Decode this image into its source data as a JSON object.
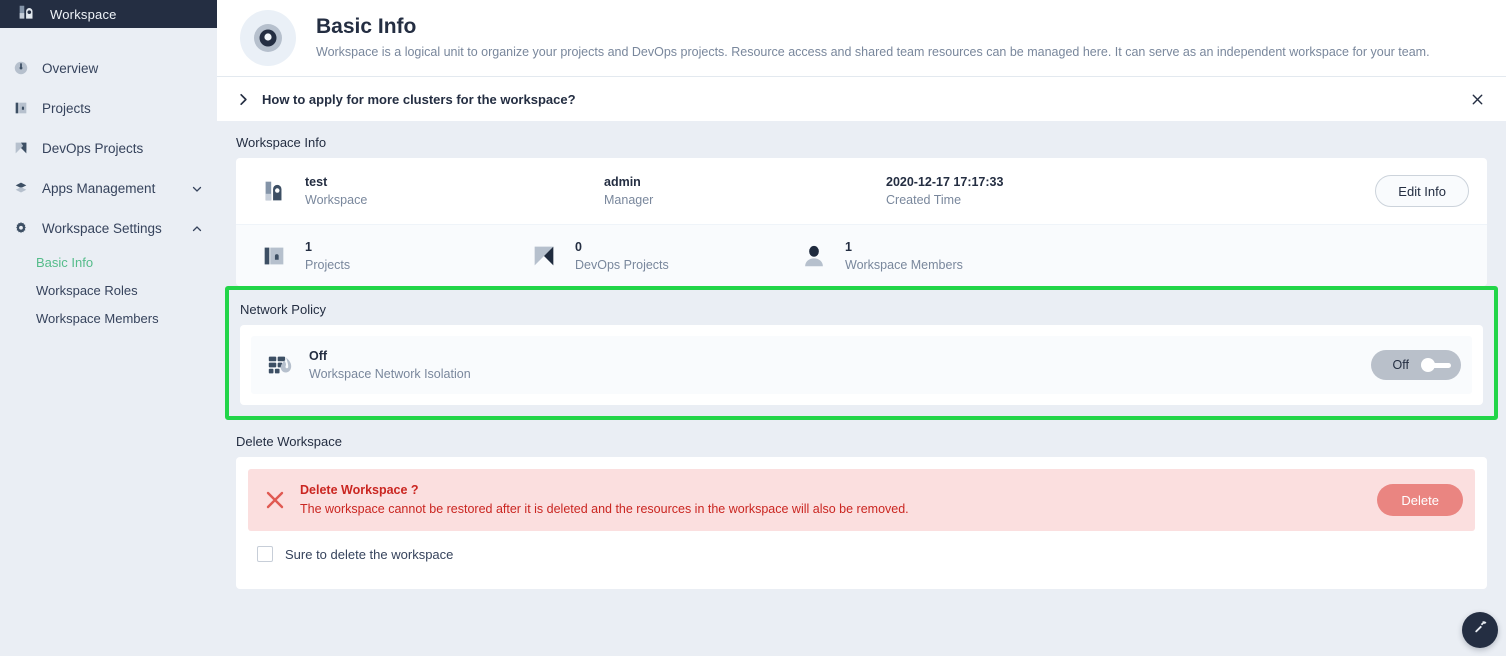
{
  "sidebar": {
    "logo_icon": "workspace-logo-icon",
    "title": "Workspace",
    "items": [
      {
        "label": "Overview",
        "icon": "overview-icon",
        "expandable": false
      },
      {
        "label": "Projects",
        "icon": "projects-icon",
        "expandable": false
      },
      {
        "label": "DevOps Projects",
        "icon": "devops-icon",
        "expandable": false
      },
      {
        "label": "Apps Management",
        "icon": "apps-icon",
        "expandable": true,
        "chevron": "chevron-down-icon"
      },
      {
        "label": "Workspace Settings",
        "icon": "gear-icon",
        "expandable": true,
        "chevron": "chevron-up-icon"
      }
    ],
    "sub_items": [
      {
        "label": "Basic Info",
        "active": true
      },
      {
        "label": "Workspace Roles",
        "active": false
      },
      {
        "label": "Workspace Members",
        "active": false
      }
    ],
    "active_color": "#55bc8a"
  },
  "header": {
    "avatar_icon": "workspace-ring-icon",
    "title": "Basic Info",
    "description": "Workspace is a logical unit to organize your projects and DevOps projects. Resource access and shared team resources can be managed here. It can serve as an independent workspace for your team."
  },
  "notice": {
    "expand_icon": "chevron-right-icon",
    "text": "How to apply for more clusters for the workspace?",
    "close_icon": "close-icon"
  },
  "workspace_info": {
    "section_title": "Workspace Info",
    "primary": [
      {
        "icon": "workspace-icon",
        "value": "test",
        "label": "Workspace"
      },
      {
        "icon": "",
        "value": "admin",
        "label": "Manager"
      },
      {
        "icon": "",
        "value": "2020-12-17 17:17:33",
        "label": "Created Time"
      }
    ],
    "edit_button": "Edit Info",
    "stats": [
      {
        "icon": "projects-icon",
        "value": "1",
        "label": "Projects"
      },
      {
        "icon": "devops-icon",
        "value": "0",
        "label": "DevOps Projects"
      },
      {
        "icon": "member-icon",
        "value": "1",
        "label": "Workspace Members"
      }
    ]
  },
  "network_policy": {
    "section_title": "Network Policy",
    "highlight_color": "#22d548",
    "icon": "firewall-icon",
    "state": "Off",
    "label": "Workspace Network Isolation",
    "toggle_label": "Off",
    "toggle_on": false
  },
  "delete_workspace": {
    "section_title": "Delete Workspace",
    "alert_icon": "error-x-icon",
    "alert_title": "Delete Workspace ?",
    "alert_text": "The workspace cannot be restored after it is deleted and the resources in the workspace will also be removed.",
    "delete_button": "Delete",
    "confirm_label": "Sure to delete the workspace",
    "confirm_checked": false,
    "alert_color": "#ca2621",
    "button_color": "#ea8581"
  },
  "fab": {
    "icon": "hammer-icon"
  }
}
